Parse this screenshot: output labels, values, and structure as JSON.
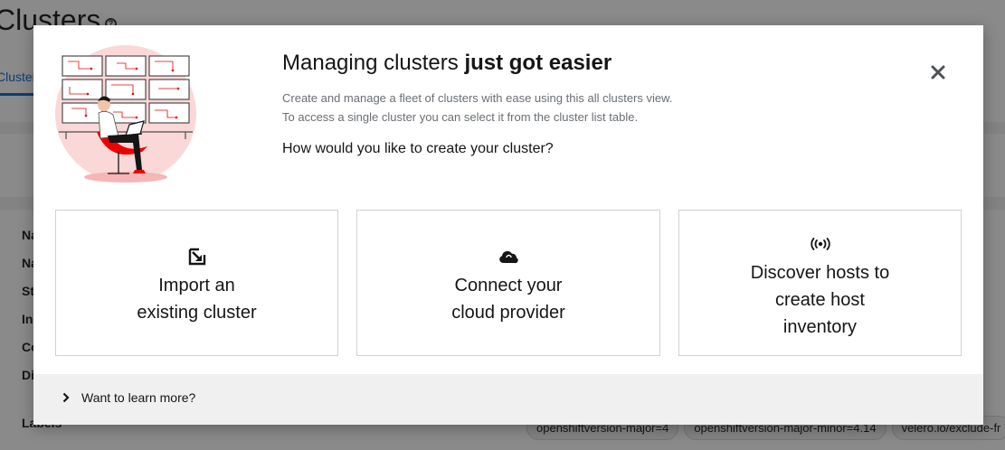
{
  "background": {
    "title": "Clusters",
    "tab": "Clusters",
    "detail_labels": [
      "Na",
      "Na",
      "St",
      "In",
      "Co",
      "Di",
      "Labels"
    ],
    "label_chips": [
      "openshiftversion-major=4",
      "openshiftversion-major-minor=4.14",
      "velero.io/exclude-fr"
    ]
  },
  "modal": {
    "title_plain": "Managing clusters ",
    "title_bold": "just got easier",
    "subtitle_line1": "Create and manage a fleet of clusters with ease using this all clusters view.",
    "subtitle_line2": "To access a single cluster you can select it from the cluster list table.",
    "question": "How would you like to create your cluster?",
    "close_icon": "close-icon",
    "cards": [
      {
        "icon": "import-icon",
        "line1": "Import an",
        "line2": "existing cluster",
        "line3": ""
      },
      {
        "icon": "cloud-icon",
        "line1": "Connect your",
        "line2": "cloud provider",
        "line3": ""
      },
      {
        "icon": "broadcast-icon",
        "line1": "Discover hosts to",
        "line2": "create host",
        "line3": "inventory"
      }
    ],
    "footer": {
      "toggle_label": "Want to learn more?",
      "icon": "chevron-right-icon"
    }
  },
  "colors": {
    "accent": "#0066cc",
    "illustration_red": "#ee0000",
    "illustration_pink": "#fbd8d8"
  }
}
